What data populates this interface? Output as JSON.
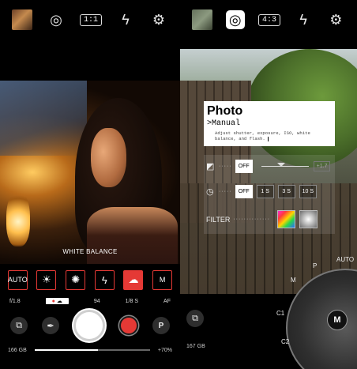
{
  "left": {
    "topbar": {
      "aspect": "1:1",
      "icons": [
        "gallery-thumbnail",
        "lens-icon",
        "aspect-ratio-button",
        "flash-icon",
        "settings-icon"
      ]
    },
    "white_balance_label": "WHITE BALANCE",
    "wb_options": [
      {
        "label": "AUTO",
        "kind": "text"
      },
      {
        "label": "☀",
        "kind": "glyph",
        "icon": "sun-icon"
      },
      {
        "label": "✺",
        "kind": "glyph",
        "icon": "bright-sun-icon"
      },
      {
        "label": "ϟ",
        "kind": "glyph",
        "icon": "flash-icon"
      },
      {
        "label": "☁",
        "kind": "glyph",
        "icon": "cloud-icon",
        "active": true
      },
      {
        "label": "M",
        "kind": "text"
      }
    ],
    "settings": {
      "aperture": "f/1.8",
      "iso": "94",
      "shutter_speed": "1/8 S",
      "focus": "AF"
    },
    "buttons": {
      "p_label": "P"
    },
    "storage": "166 GB",
    "zoom": "+70%"
  },
  "right": {
    "topbar": {
      "aspect": "4:3"
    },
    "info": {
      "title": "Photo",
      "mode": ">Manual",
      "description": "Adjust shutter, exposure, ISO, white balance, and flash."
    },
    "exposure": {
      "off": "OFF",
      "value": "+1.7"
    },
    "timer": {
      "options": [
        "OFF",
        "1 S",
        "3 S",
        "10 S"
      ],
      "active_index": 0
    },
    "filter_label": "FILTER",
    "dial": {
      "center": "M",
      "labels": [
        "AUTO",
        "P",
        "M",
        "C1",
        "C2"
      ]
    },
    "storage": "167 GB"
  },
  "colors": {
    "accent_red": "#e53935",
    "background": "#000000"
  }
}
